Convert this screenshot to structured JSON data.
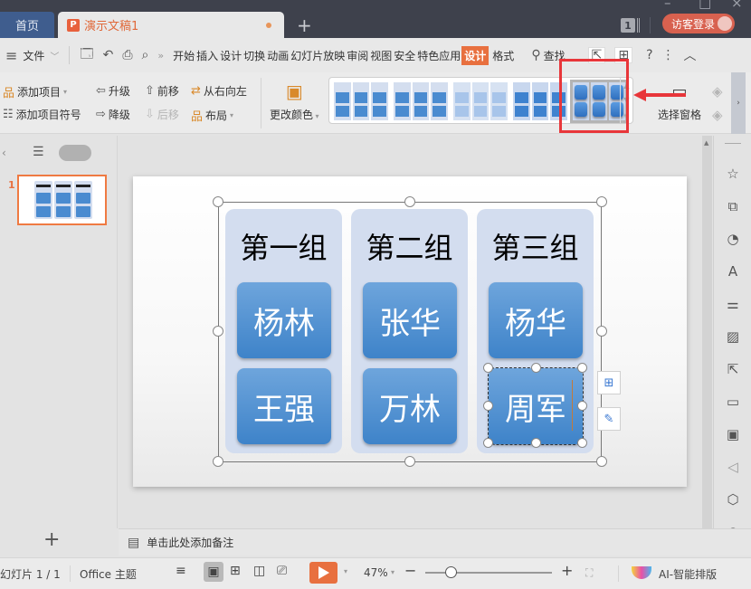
{
  "titlebar": {
    "home_tab": "首页",
    "doc_tab": "演示文稿1",
    "doc_icon": "P",
    "new_tab_icon": "+",
    "window_count": "1",
    "login_label": "访客登录",
    "minimize_icon": "–",
    "maximize_icon": "□",
    "close_icon": "×"
  },
  "menubar": {
    "menu_icon": "≡",
    "file_label": "文件",
    "more_icon": "»",
    "tabs": [
      "开始",
      "插入",
      "设计",
      "切换",
      "动画",
      "幻灯片放映",
      "审阅",
      "视图",
      "安全",
      "特色应用",
      "设计",
      "格式"
    ],
    "active_tab_index": 10,
    "search_label": "查找",
    "help_icon": "?",
    "more_vert_icon": "⋮",
    "collapse_icon": "︿"
  },
  "ribbon": {
    "add_item": "添加项目",
    "add_bullet": "添加项目符号",
    "promote": "升级",
    "demote": "降级",
    "move_up": "前移",
    "move_down": "后移",
    "right_to_left": "从右向左",
    "layout": "布局",
    "change_colors": "更改颜色",
    "select_pane": "选择窗格",
    "gallery_styles": [
      "style-1",
      "style-2",
      "style-3",
      "style-4",
      "style-5"
    ],
    "gallery_selected_index": 4
  },
  "left_panel": {
    "slide_number": "1",
    "add_slide_icon": "+"
  },
  "slide": {
    "groups": [
      {
        "title": "第一组",
        "members": [
          "杨林",
          "王强"
        ]
      },
      {
        "title": "第二组",
        "members": [
          "张华",
          "万林"
        ]
      },
      {
        "title": "第三组",
        "members": [
          "杨华",
          "周军"
        ]
      }
    ],
    "selected_member": "周军"
  },
  "notes": {
    "placeholder": "单击此处添加备注"
  },
  "statusbar": {
    "slide_info": "幻灯片 1 / 1",
    "theme": "Office 主题",
    "zoom": "47%",
    "zoom_fraction": 0.2,
    "ai_label": "AI-智能排版"
  },
  "colors": {
    "accent": "#e8703f",
    "highlight_box": "#e8363a",
    "node_blue": "#4a8bd0",
    "group_bg": "#d3ddef"
  }
}
